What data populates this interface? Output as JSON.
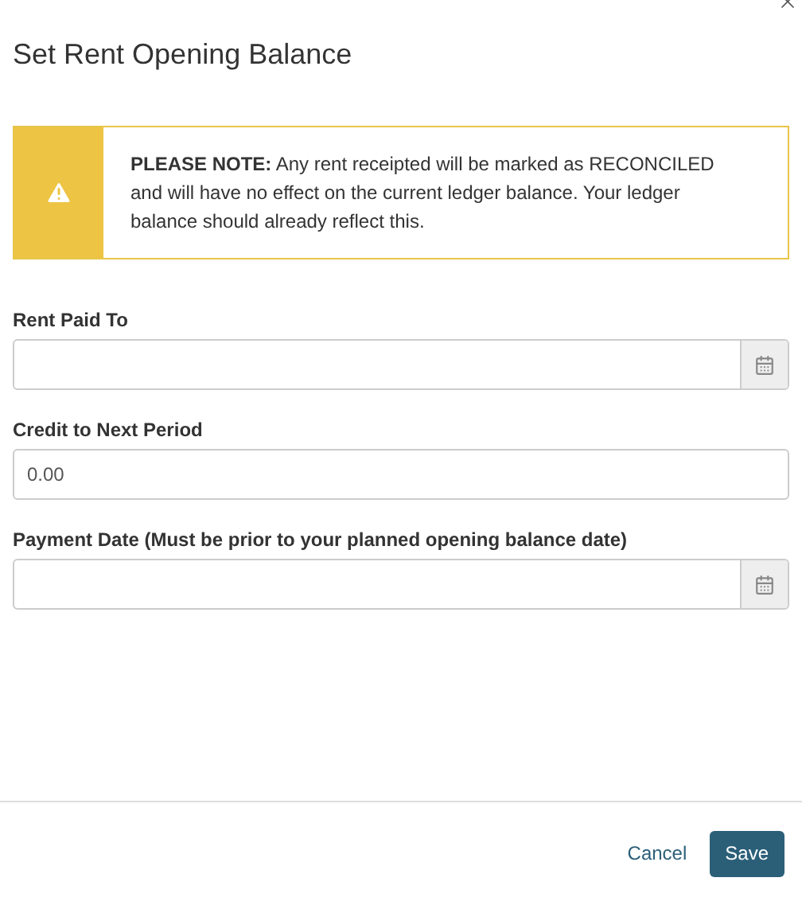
{
  "dialog": {
    "title": "Set Rent Opening Balance"
  },
  "notice": {
    "text": "**PLEASE NOTE:** Any rent receipted will be marked as RECONCILED and will have no effect on the current ledger balance. Your ledger balance should already reflect this."
  },
  "fields": [
    {
      "label": "Rent Paid To",
      "kind": "date"
    },
    {
      "label": "Credit to Next Period",
      "kind": "text",
      "value": "0.00"
    },
    {
      "label": "Payment Date (Must be prior to your planned opening balance date)",
      "kind": "date"
    }
  ],
  "buttons": [
    {
      "label": "Cancel",
      "kind": "link"
    },
    {
      "label": "Save",
      "kind": "primary"
    }
  ]
}
